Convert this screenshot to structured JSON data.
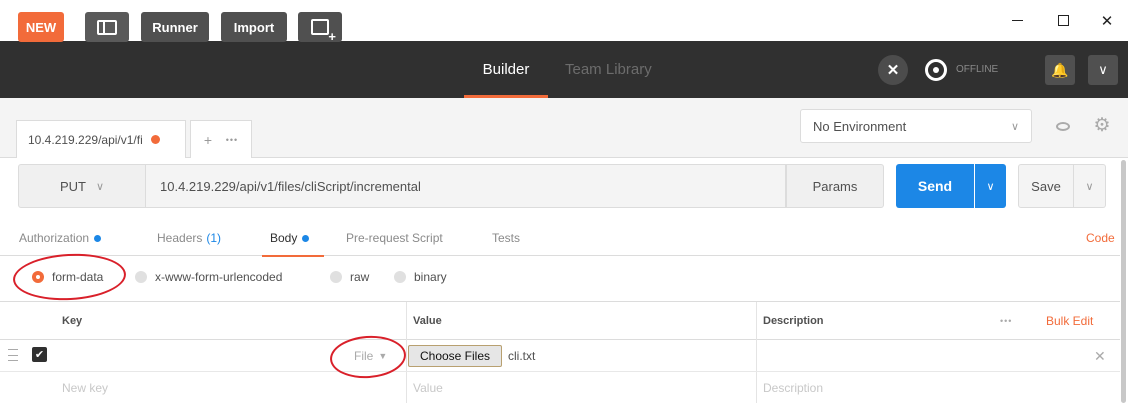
{
  "window_controls": {
    "minimize": "minimize",
    "maximize": "maximize",
    "close": "✕"
  },
  "header": {
    "new_label": "NEW",
    "runner_label": "Runner",
    "import_label": "Import",
    "builder_tab": "Builder",
    "team_library_tab": "Team Library",
    "offline_label": "OFFLINE",
    "accent_color": "#f26b3a",
    "icons": [
      "sidebar-toggle-icon",
      "new-window-icon",
      "interceptor-icon",
      "sync-icon",
      "bell-icon",
      "chevron-down-icon"
    ]
  },
  "request_tab": {
    "title": "10.4.219.229/api/v1/fi",
    "add": "+",
    "more": "•••"
  },
  "environment": {
    "selected": "No Environment",
    "chevron": "∨"
  },
  "request": {
    "method": "PUT",
    "url": "10.4.219.229/api/v1/files/cliScript/incremental",
    "params_label": "Params",
    "send_label": "Send",
    "save_label": "Save",
    "send_color": "#1c87e6"
  },
  "subtabs": {
    "authorization": "Authorization",
    "headers": "Headers",
    "headers_count": "(1)",
    "body": "Body",
    "pre_request": "Pre-request Script",
    "tests": "Tests",
    "code": "Code"
  },
  "body_types": {
    "form_data": "form-data",
    "urlencoded": "x-www-form-urlencoded",
    "raw": "raw",
    "binary": "binary",
    "selected": "form-data"
  },
  "table": {
    "headers": {
      "key": "Key",
      "value": "Value",
      "description": "Description",
      "more": "•••",
      "bulk_edit": "Bulk Edit"
    },
    "rows": [
      {
        "checked": true,
        "key": "",
        "type": "File",
        "choose_files": "Choose Files",
        "file_name": "cli.txt",
        "delete": "✕"
      }
    ],
    "placeholders": {
      "key": "New key",
      "value": "Value",
      "description": "Description"
    }
  },
  "annotation_color": "#d9202a"
}
